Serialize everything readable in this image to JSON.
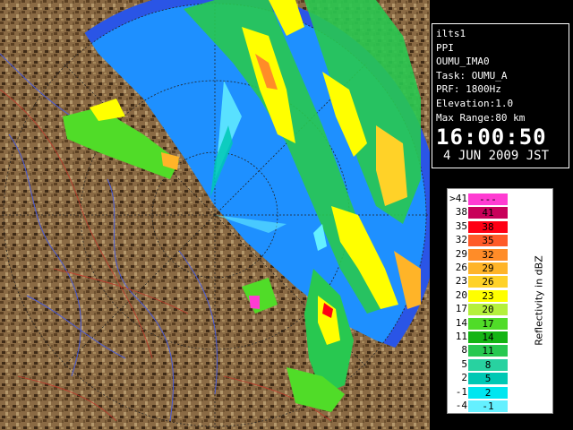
{
  "radar": {
    "site": "ilts1",
    "product": "PPI",
    "scan": "OUMU_IMA0",
    "task": "Task: OUMU_A",
    "prf": "PRF: 1800Hz",
    "elevation": "Elevation:1.0",
    "max_range": "Max Range:80 km",
    "time": "16:00:50",
    "date": "4 JUN 2009 JST"
  },
  "legend": {
    "title": "Reflectivity in dBZ",
    "rows": [
      {
        "low": ">41",
        "high": "---",
        "color": "#ff3cd2"
      },
      {
        "low": "38",
        "high": "41",
        "color": "#c8005a"
      },
      {
        "low": "35",
        "high": "38",
        "color": "#ff0014"
      },
      {
        "low": "32",
        "high": "35",
        "color": "#ff5a28"
      },
      {
        "low": "29",
        "high": "32",
        "color": "#ff8c28"
      },
      {
        "low": "26",
        "high": "29",
        "color": "#ffb428"
      },
      {
        "low": "23",
        "high": "26",
        "color": "#ffd228"
      },
      {
        "low": "20",
        "high": "23",
        "color": "#ffff00"
      },
      {
        "low": "17",
        "high": "20",
        "color": "#b4f03c"
      },
      {
        "low": "14",
        "high": "17",
        "color": "#50dc28"
      },
      {
        "low": "11",
        "high": "14",
        "color": "#14b414"
      },
      {
        "low": "8",
        "high": "11",
        "color": "#28c850"
      },
      {
        "low": "5",
        "high": "8",
        "color": "#28d2a0"
      },
      {
        "low": "2",
        "high": "5",
        "color": "#00c8b4"
      },
      {
        "low": "-1",
        "high": "2",
        "color": "#00e6f0"
      },
      {
        "low": "-4",
        "high": "-1",
        "color": "#64f0ff"
      }
    ]
  }
}
